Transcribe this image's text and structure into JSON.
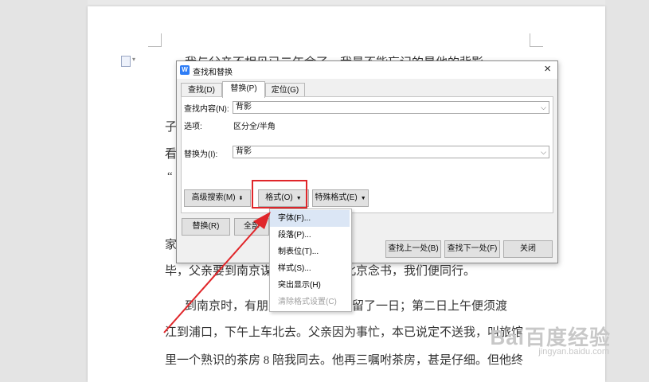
{
  "document": {
    "lines": [
      "我与父亲不相见已二年余了，我最不能忘记的是他的背影",
      "子",
      "看",
      "“",
      "家",
      "毕，父亲要到南京谋事，我也要回北京念书，我们便同行。",
      "到南京时，有朋友约去游逛，勾留了一日；第二日上午便须渡",
      "江到浦口，下午上车北去。父亲因为事忙，本已说定不送我，叫旅馆",
      "里一个熟识的茶房 8 陪我同去。他再三嘱咐茶房，甚是仔细。但他终"
    ]
  },
  "dialog": {
    "title": "查找和替换",
    "tabs": [
      {
        "label": "查找(D)"
      },
      {
        "label": "替换(P)"
      },
      {
        "label": "定位(G)"
      }
    ],
    "active_tab": 1,
    "find_label": "查找内容(N):",
    "find_value": "背影",
    "options_label": "选项:",
    "options_value": "区分全/半角",
    "replace_label": "替换为(I):",
    "replace_value": "背影",
    "advanced_search": "高级搜索(M)",
    "format": "格式(O)",
    "special_format": "特殊格式(E)",
    "replace_btn": "替换(R)",
    "replace_all_btn": "全部",
    "find_prev": "查找上一处(B)",
    "find_next": "查找下一处(F)",
    "close": "关闭"
  },
  "menu": {
    "items": [
      {
        "label": "字体(F)...",
        "state": "hover"
      },
      {
        "label": "段落(P)...",
        "state": "normal"
      },
      {
        "label": "制表位(T)...",
        "state": "normal"
      },
      {
        "label": "样式(S)...",
        "state": "normal"
      },
      {
        "label": "突出显示(H)",
        "state": "normal"
      },
      {
        "label": "清除格式设置(C)",
        "state": "disabled"
      }
    ]
  },
  "watermark": {
    "brand": "Bai百度经验",
    "url": "jingyan.baidu.com"
  },
  "colors": {
    "highlight": "#e0262a",
    "app_icon": "#2e7df6",
    "menu_hover": "#dbe6f5"
  },
  "icons": {
    "app": "wps-writer-icon",
    "close": "close-icon",
    "doc": "document-icon"
  }
}
